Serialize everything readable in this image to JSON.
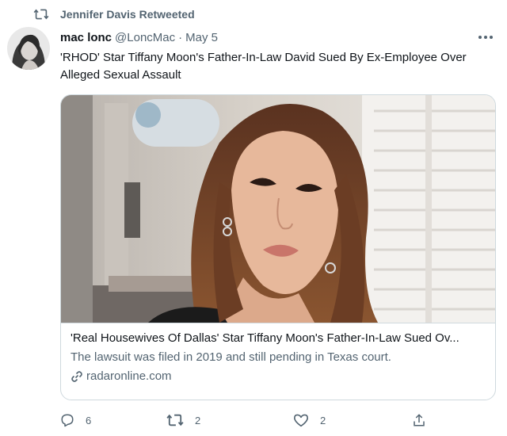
{
  "retweet": {
    "label": "Jennifer Davis Retweeted"
  },
  "author": {
    "name": "mac lonc",
    "handle": "@LoncMac",
    "separator": "·",
    "date": "May 5"
  },
  "tweet": {
    "text": "'RHOD' Star Tiffany Moon's Father-In-Law David Sued By Ex-Employee Over Alleged Sexual Assault"
  },
  "card": {
    "title": "'Real Housewives Of Dallas' Star Tiffany Moon's Father-In-Law Sued Ov...",
    "description": "The lawsuit was filed in 2019 and still pending in Texas court.",
    "domain": "radaronline.com"
  },
  "actions": {
    "replies": "6",
    "retweets": "2",
    "likes": "2"
  },
  "icons": {
    "retweet": "retweet-icon",
    "more": "more-icon",
    "reply": "reply-icon",
    "like": "heart-icon",
    "share": "share-icon",
    "link": "link-icon"
  },
  "colors": {
    "secondary_text": "#536471",
    "primary_text": "#0f1419",
    "border": "#cfd9de"
  }
}
